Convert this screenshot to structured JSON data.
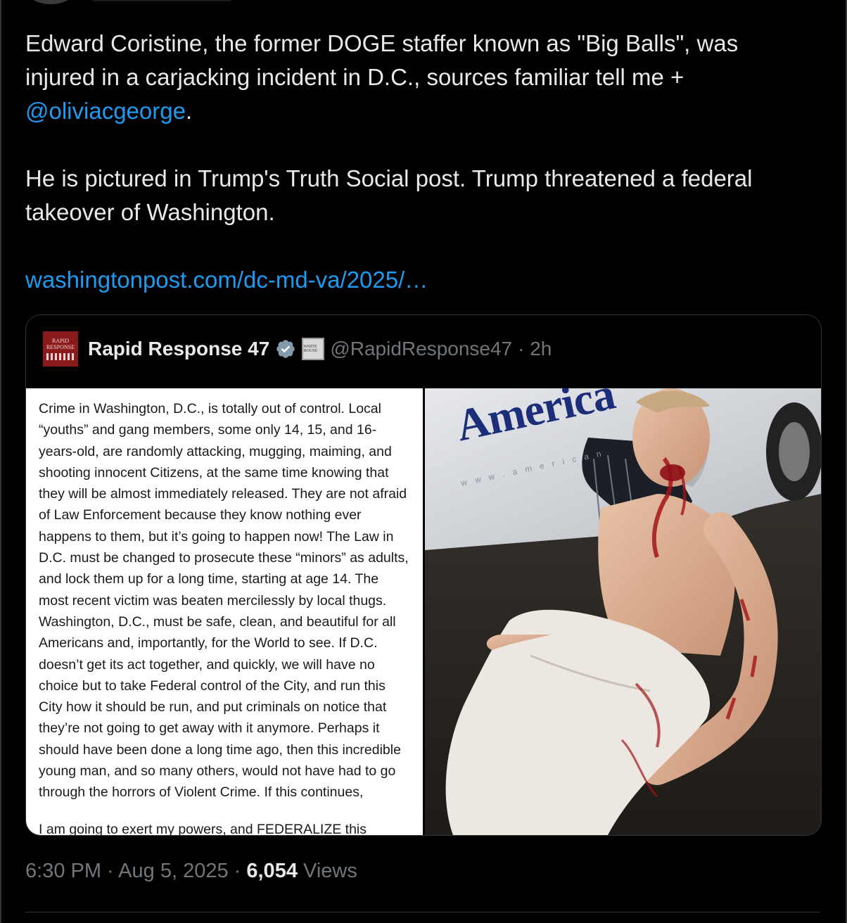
{
  "tweet": {
    "line1": "Edward Coristine, the former DOGE staffer known as \"Big Balls\", was injured in a carjacking incident in D.C., sources familiar tell me +",
    "mention": "@oliviacgeorge",
    "mention_suffix": ".",
    "paragraph2": "He is pictured in Trump's Truth Social post. Trump threatened a federal takeover of Washington.",
    "link": "washingtonpost.com/dc-md-va/2025/…"
  },
  "quote": {
    "avatar_text_1": "RAPID",
    "avatar_text_2": "RESPONSE",
    "name": "Rapid Response 47",
    "badge_text": "WHITE HOUSE",
    "handle": "@RapidResponse47",
    "time": "· 2h",
    "truth_text": "Crime in Washington, D.C., is totally out of control. Local “youths” and gang members, some only 14, 15, and 16-years-old, are randomly attacking, mugging, maiming, and shooting innocent Citizens, at the same time knowing that they will be almost immediately released. They are not afraid of Law Enforcement because they know nothing ever happens to them, but it’s going to happen now! The Law in D.C. must be changed to prosecute these “minors” as adults, and lock them up for a long time, starting at age 14. The most recent victim was beaten mercilessly by local thugs. Washington, D.C., must be safe, clean, and beautiful for all Americans and, importantly, for the World to see. If D.C. doesn’t get its act together, and quickly, we will have no choice but to take Federal control of the City, and run this City how it should be run, and put criminals on notice that they’re not going to get away with it anymore. Perhaps it should have been done a long time ago, then this incredible young man, and so many others, would not have had to go through the horrors of Violent Crime. If this continues,",
    "truth_cut": "I am going to exert my powers, and FEDERALIZE this",
    "van_text": "America",
    "van_url": "w w w . a m e r i c a n"
  },
  "footer": {
    "time": "6:30 PM",
    "sep1": " · ",
    "date": "Aug 5, 2025",
    "sep2": " · ",
    "views_count": "6,054",
    "views_label": " Views"
  },
  "colors": {
    "background": "#000000",
    "text": "#e7e9ea",
    "muted": "#71767b",
    "link": "#1d9bf0",
    "verified": "#829aab"
  }
}
